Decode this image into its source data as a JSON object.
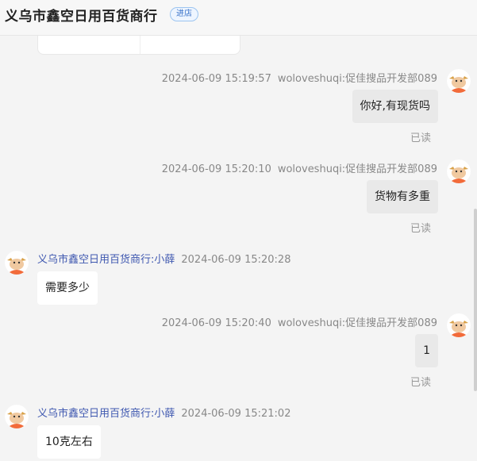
{
  "header": {
    "shop_name": "义乌市鑫空日用百货商行",
    "enter_store": "进店"
  },
  "messages": [
    {
      "direction": "out",
      "timestamp": "2024-06-09 15:19:57",
      "sender": "woloveshuqi:促佳搜品开发部089",
      "text": "你好,有现货吗",
      "status": "已读"
    },
    {
      "direction": "out",
      "timestamp": "2024-06-09 15:20:10",
      "sender": "woloveshuqi:促佳搜品开发部089",
      "text": "货物有多重",
      "status": "已读"
    },
    {
      "direction": "in",
      "timestamp": "2024-06-09 15:20:28",
      "sender": "义乌市鑫空日用百货商行:小薛",
      "text": "需要多少"
    },
    {
      "direction": "out",
      "timestamp": "2024-06-09 15:20:40",
      "sender": "woloveshuqi:促佳搜品开发部089",
      "text": "1",
      "status": "已读"
    },
    {
      "direction": "in",
      "timestamp": "2024-06-09 15:21:02",
      "sender": "义乌市鑫空日用百货商行:小薛",
      "text": "10克左右"
    }
  ],
  "colors": {
    "background": "#f4f4f4",
    "outgoing_bubble": "#e9e9e9",
    "incoming_bubble": "#ffffff",
    "sender_name": "#3f58b0",
    "avatar": "#f26b3a"
  },
  "icons": {
    "avatar": "cartoon-cow-avatar-icon"
  }
}
